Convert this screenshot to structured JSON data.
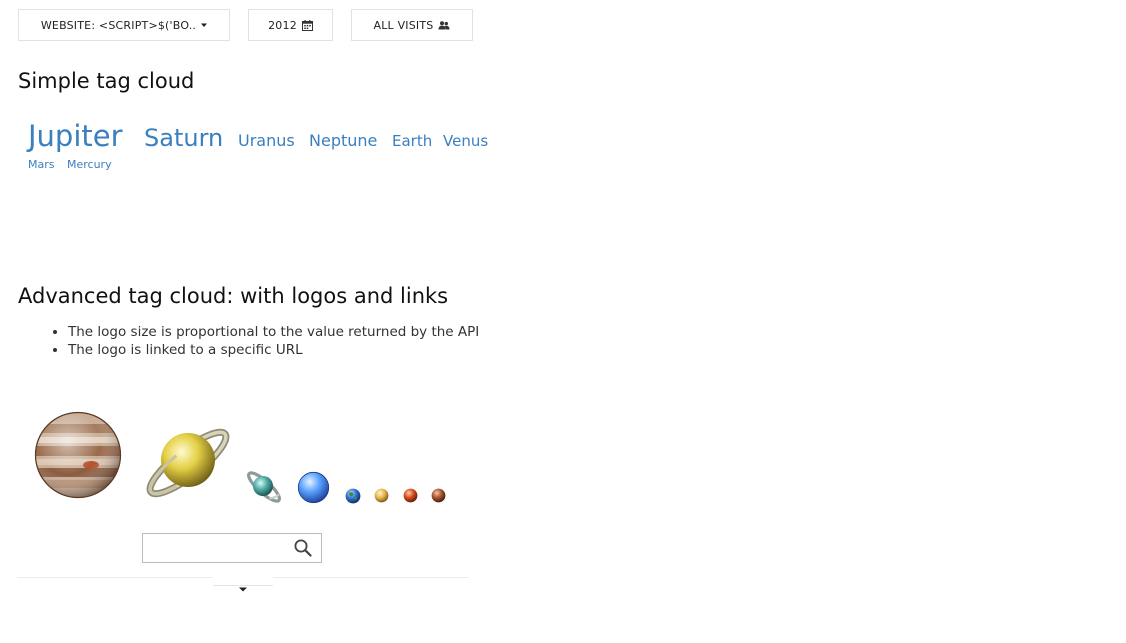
{
  "toolbar": {
    "website_label": "WEBSITE: <SCRIPT>$('BO..",
    "date_label": "2012",
    "segment_label": "ALL VISITS"
  },
  "simple_cloud": {
    "title": "Simple tag cloud",
    "tags": [
      "Jupiter",
      "Saturn",
      "Uranus",
      "Neptune",
      "Earth",
      "Venus",
      "Mars",
      "Mercury"
    ]
  },
  "advanced_cloud": {
    "title": "Advanced tag cloud: with logos and links",
    "notes": [
      "The logo size is proportional to the value returned by the API",
      "The logo is linked to a specific URL"
    ],
    "logos": [
      "jupiter-logo",
      "saturn-logo",
      "uranus-logo",
      "neptune-logo",
      "earth-logo",
      "venus-logo",
      "mars-logo",
      "mercury-logo"
    ]
  },
  "search": {
    "value": "",
    "placeholder": ""
  },
  "icons": {
    "website": "caret-down-icon",
    "date": "calendar-icon",
    "segment": "users-icon",
    "search": "search-icon",
    "footer": "caret-down-icon"
  },
  "colors": {
    "link": "#3a7fc0",
    "border": "#e2e2e2",
    "text": "#222222"
  }
}
